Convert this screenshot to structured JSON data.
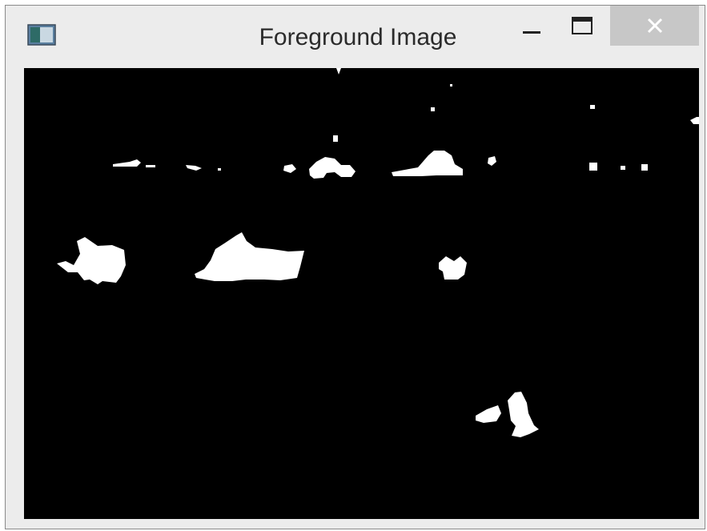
{
  "window": {
    "title": "Foreground Image",
    "icon": "window-app-icon",
    "controls": {
      "minimize_icon": "minimize-icon",
      "maximize_icon": "maximize-icon",
      "close_icon": "close-icon"
    }
  },
  "image_view": {
    "background_color": "#000000",
    "foreground_color": "#ffffff"
  }
}
